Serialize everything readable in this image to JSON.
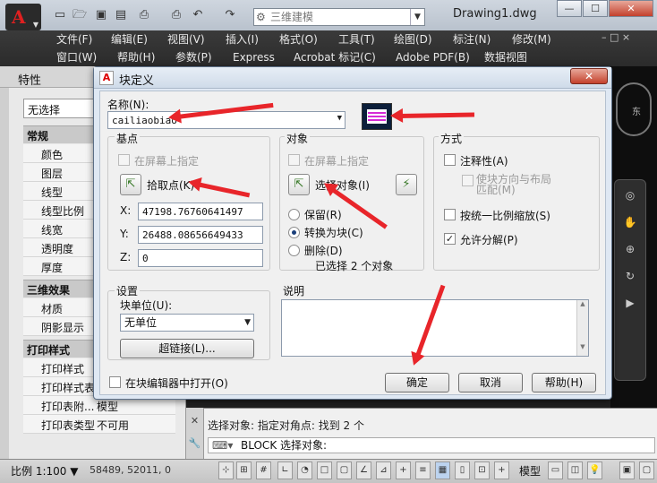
{
  "titlebar": {
    "workspace": "三维建模",
    "document": "Drawing1.dwg",
    "min": "—",
    "max": "☐",
    "close": "✕"
  },
  "menus": {
    "row1": [
      "文件(F)",
      "编辑(E)",
      "视图(V)",
      "插入(I)",
      "格式(O)",
      "工具(T)",
      "绘图(D)",
      "标注(N)",
      "修改(M)"
    ],
    "row2": [
      "窗口(W)",
      "帮助(H)",
      "参数(P)",
      "Express",
      "Acrobat 标记(C)",
      "Adobe PDF(B)",
      "数据视图"
    ],
    "mdi_controls": "–  □  ×"
  },
  "properties": {
    "title": "特性",
    "selection": "无选择",
    "sections": [
      {
        "title": "常规",
        "rows": [
          "颜色",
          "图层",
          "线型",
          "线型比例",
          "线宽",
          "透明度",
          "厚度"
        ]
      },
      {
        "title": "三维效果",
        "rows": [
          "材质",
          "阴影显示"
        ]
      },
      {
        "title": "打印样式",
        "rows": [
          "打印样式",
          "打印样式表",
          "打印表附...",
          "打印表类型"
        ]
      }
    ],
    "row_values": {
      "print_attach": "模型",
      "print_type": "不可用"
    }
  },
  "compass": {
    "east": "东"
  },
  "dialog": {
    "title": "块定义",
    "close": "✕",
    "name_label": "名称(N):",
    "name_value": "cailiaobiao",
    "base_point": {
      "title": "基点",
      "on_screen": "在屏幕上指定",
      "pick_button": "拾取点(K)",
      "x_label": "X:",
      "x_value": "47198.76760641497",
      "y_label": "Y:",
      "y_value": "26488.08656649433",
      "z_label": "Z:",
      "z_value": "0"
    },
    "objects": {
      "title": "对象",
      "on_screen": "在屏幕上指定",
      "select_button": "选择对象(I)",
      "retain": "保留(R)",
      "convert": "转换为块(C)",
      "delete": "删除(D)",
      "selected_text": "已选择 2 个对象"
    },
    "behavior": {
      "title": "方式",
      "annotative": "注释性(A)",
      "match_orientation": "使块方向与布局匹配(M)",
      "scale_uniformly": "按统一比例缩放(S)",
      "allow_explode": "允许分解(P)"
    },
    "settings": {
      "title": "设置",
      "unit_label": "块单位(U):",
      "unit_value": "无单位",
      "hyperlink": "超链接(L)..."
    },
    "description": {
      "title": "说明",
      "text": ""
    },
    "open_in_editor": "在块编辑器中打开(O)",
    "ok": "确定",
    "cancel": "取消",
    "help": "帮助(H)"
  },
  "command": {
    "history": "选择对象: 指定对角点: 找到 2 个",
    "prompt": "BLOCK 选择对象:"
  },
  "status": {
    "scale": "比例 1:100",
    "coords": "58489, 52011, 0",
    "model": "模型"
  },
  "colors": {
    "accent_arrow": "#e8252a",
    "dialog_bg": "#dfe8f3"
  }
}
